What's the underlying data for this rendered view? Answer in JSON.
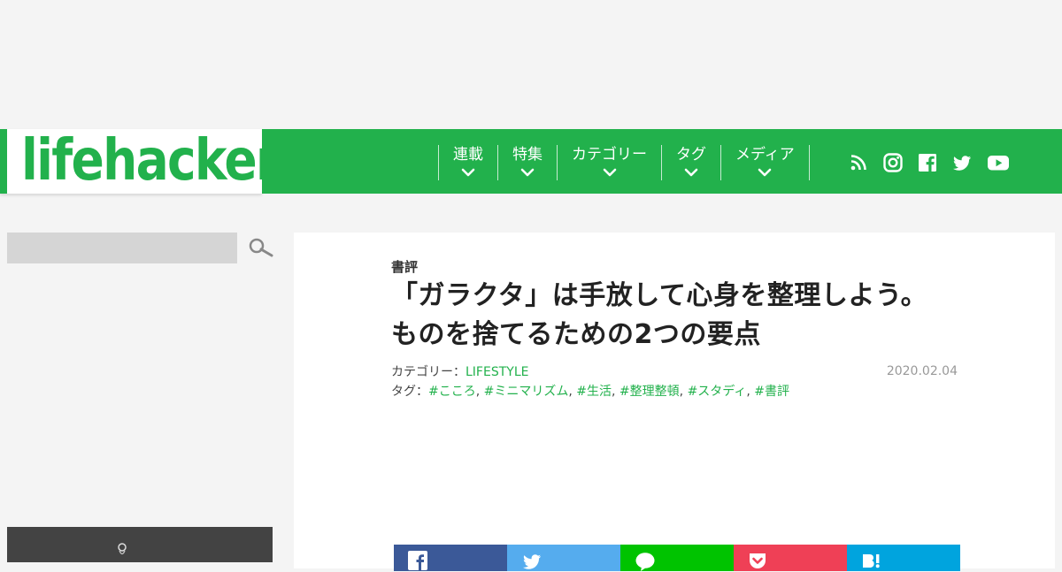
{
  "brand": {
    "logo_text": "lifehacker",
    "color": "#22b14c"
  },
  "nav": {
    "items": [
      {
        "label": "連載"
      },
      {
        "label": "特集"
      },
      {
        "label": "カテゴリー"
      },
      {
        "label": "タグ"
      },
      {
        "label": "メディア"
      }
    ],
    "social_icons": [
      "rss-icon",
      "instagram-icon",
      "facebook-icon",
      "twitter-icon",
      "youtube-icon"
    ]
  },
  "search": {
    "placeholder": ""
  },
  "article": {
    "category_label": "書評",
    "title_line1": "「ガラクタ」は手放して心身を整理しよう。",
    "title_line2": "ものを捨てるための2つの要点",
    "meta_category_prefix": "カテゴリー：",
    "meta_category_value": "LIFESTYLE",
    "meta_tags_prefix": "タグ：",
    "tags": [
      "#こころ",
      "#ミニマリズム",
      "#生活",
      "#整理整頓",
      "#スタディ",
      "#書評"
    ],
    "date": "2020.02.04"
  },
  "share": {
    "buttons": [
      {
        "name": "facebook",
        "color": "#3b5998"
      },
      {
        "name": "twitter",
        "color": "#55acee"
      },
      {
        "name": "line",
        "color": "#00c300"
      },
      {
        "name": "pocket",
        "color": "#ef4056"
      },
      {
        "name": "hatena",
        "color": "#00a4de"
      }
    ]
  }
}
